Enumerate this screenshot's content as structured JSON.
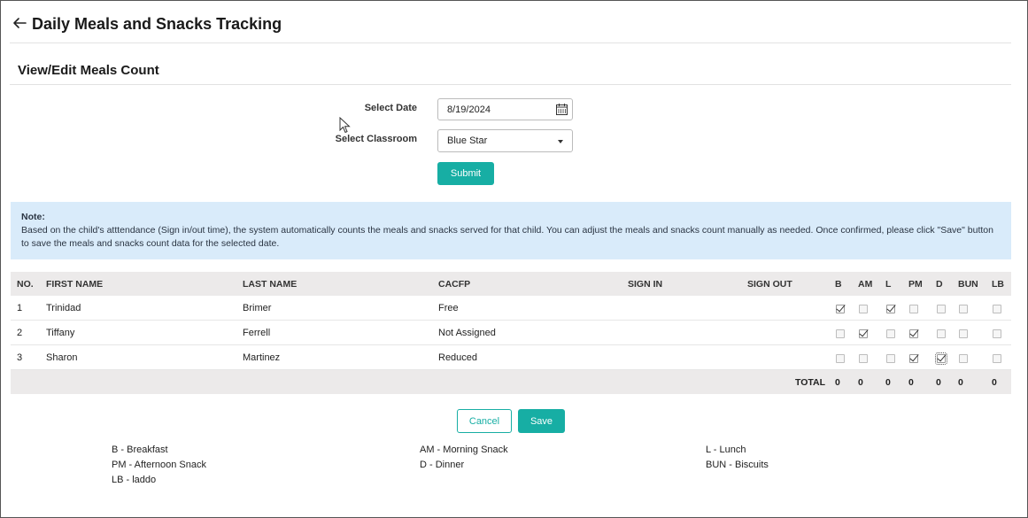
{
  "header": {
    "title": "Daily Meals and Snacks Tracking",
    "back_icon": "arrow-left-icon"
  },
  "section": {
    "title": "View/Edit Meals Count"
  },
  "form": {
    "date_label": "Select Date",
    "date_value": "8/19/2024",
    "classroom_label": "Select Classroom",
    "classroom_value": "Blue Star",
    "submit_label": "Submit"
  },
  "note": {
    "title": "Note:",
    "text": "Based on the child's atttendance (Sign in/out time), the system automatically counts the meals and snacks served for that child. You can adjust the meals and snacks count manually as needed. Once confirmed, please click \"Save\" button to save the meals and snacks count data for the selected date."
  },
  "table": {
    "columns": {
      "no": "NO.",
      "first_name": "FIRST NAME",
      "last_name": "LAST NAME",
      "cacfp": "CACFP",
      "sign_in": "SIGN IN",
      "sign_out": "SIGN OUT",
      "meals": [
        "B",
        "AM",
        "L",
        "PM",
        "D",
        "BUN",
        "LB"
      ]
    },
    "rows": [
      {
        "no": "1",
        "first_name": "Trinidad",
        "last_name": "Brimer",
        "cacfp": "Free",
        "sign_in": "",
        "sign_out": "",
        "meals": [
          true,
          false,
          true,
          false,
          false,
          false,
          false
        ]
      },
      {
        "no": "2",
        "first_name": "Tiffany",
        "last_name": "Ferrell",
        "cacfp": "Not Assigned",
        "sign_in": "",
        "sign_out": "",
        "meals": [
          false,
          true,
          false,
          true,
          false,
          false,
          false
        ]
      },
      {
        "no": "3",
        "first_name": "Sharon",
        "last_name": "Martinez",
        "cacfp": "Reduced",
        "sign_in": "",
        "sign_out": "",
        "meals": [
          false,
          false,
          false,
          true,
          true,
          false,
          false
        ]
      }
    ],
    "total_label": "TOTAL",
    "totals": [
      "0",
      "0",
      "0",
      "0",
      "0",
      "0",
      "0"
    ]
  },
  "actions": {
    "cancel_label": "Cancel",
    "save_label": "Save"
  },
  "legend": {
    "b": "B - Breakfast",
    "am": "AM - Morning Snack",
    "l": "L - Lunch",
    "pm": "PM - Afternoon Snack",
    "d": "D - Dinner",
    "bun": "BUN - Biscuits",
    "lb": "LB - laddo"
  },
  "colors": {
    "accent": "#17aea4",
    "note_bg": "#d9ebfa",
    "table_header_bg": "#eceaea"
  }
}
